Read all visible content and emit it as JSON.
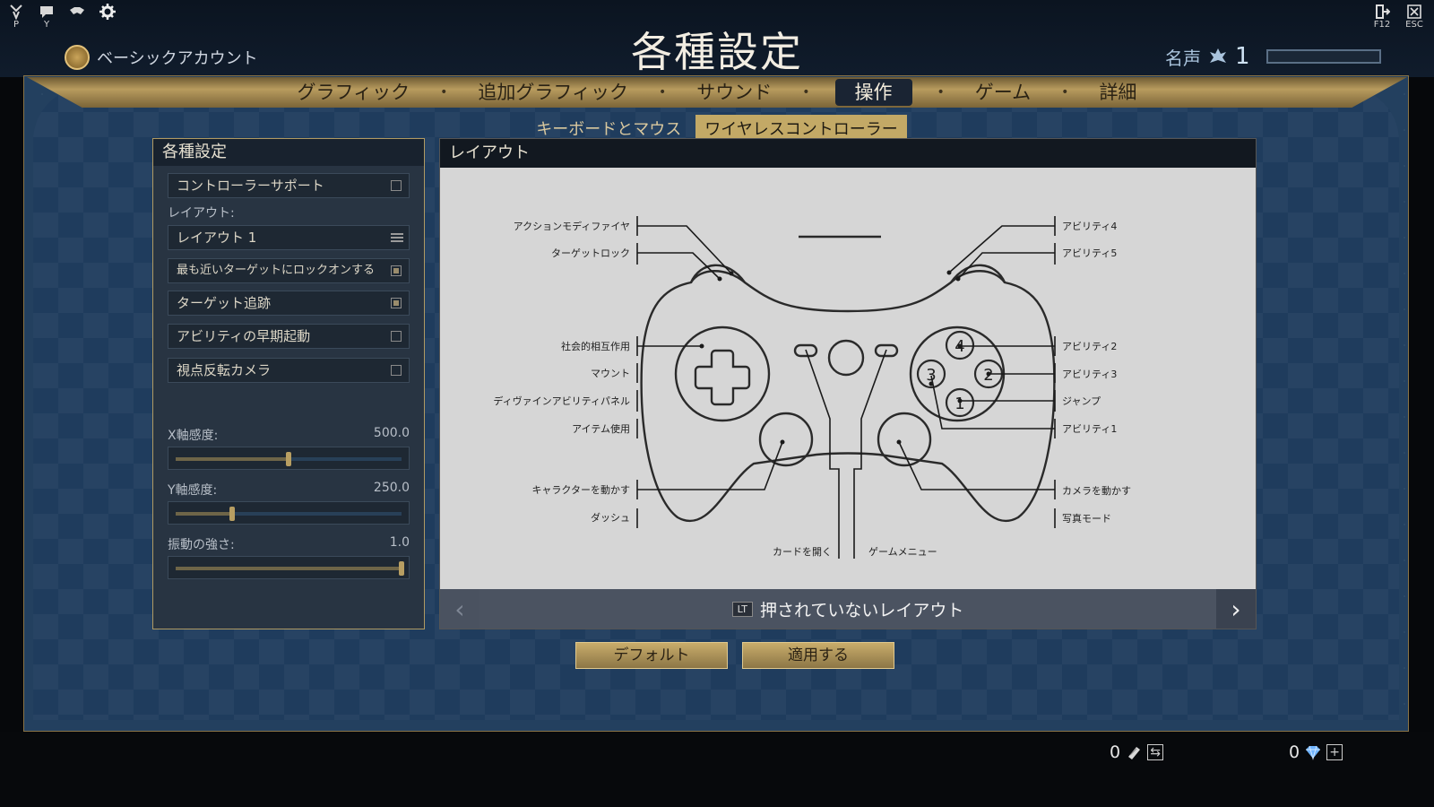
{
  "top_left_icons": [
    {
      "name": "pvp",
      "key": "P"
    },
    {
      "name": "chat",
      "key": "Y"
    },
    {
      "name": "handshake",
      "key": ""
    },
    {
      "name": "settings",
      "key": ""
    }
  ],
  "account": {
    "label": "ベーシックアカウント"
  },
  "title": "各種設定",
  "fame": {
    "label": "名声",
    "value": "1",
    "progress": 0
  },
  "top_right_icons": [
    {
      "name": "exit-door",
      "key": "F12"
    },
    {
      "name": "close",
      "key": "ESC"
    }
  ],
  "tabs": [
    "グラフィック",
    "追加グラフィック",
    "サウンド",
    "操作",
    "ゲーム",
    "詳細"
  ],
  "active_tab": "操作",
  "subtabs": [
    "キーボードとマウス",
    "ワイヤレスコントローラー"
  ],
  "active_subtab": "ワイヤレスコントローラー",
  "settings": {
    "title": "各種設定",
    "controller_support": {
      "label": "コントローラーサポート",
      "checked": false
    },
    "layout_label": "レイアウト:",
    "layout_value": "レイアウト 1",
    "lock_nearest": {
      "label": "最も近いターゲットにロックオンする",
      "checked": true
    },
    "target_tracking": {
      "label": "ターゲット追跡",
      "checked": true
    },
    "early_ability": {
      "label": "アビリティの早期起動",
      "checked": false
    },
    "invert_camera": {
      "label": "視点反転カメラ",
      "checked": false
    },
    "x_sens": {
      "label": "X軸感度:",
      "value": "500.0",
      "fraction": 0.5
    },
    "y_sens": {
      "label": "Y軸感度:",
      "value": "250.0",
      "fraction": 0.25
    },
    "vibration": {
      "label": "振動の強さ:",
      "value": "1.0",
      "fraction": 1.0
    }
  },
  "layout_panel": {
    "title": "レイアウト",
    "labels_left": [
      "アクションモディファイヤ",
      "ターゲットロック",
      "社会的相互作用",
      "マウント",
      "ディヴァインアビリティパネル",
      "アイテム使用",
      "キャラクターを動かす",
      "ダッシュ"
    ],
    "labels_right": [
      "アビリティ4",
      "アビリティ5",
      "アビリティ2",
      "アビリティ3",
      "ジャンプ",
      "アビリティ1",
      "カメラを動かす",
      "写真モード"
    ],
    "labels_bottom": [
      "カードを開く",
      "ゲームメニュー"
    ],
    "face_buttons": [
      "4",
      "2",
      "3",
      "1"
    ],
    "nav_badge": "LT",
    "nav_text": "押されていないレイアウト",
    "nav_prev": "‹",
    "nav_next": "›"
  },
  "buttons": {
    "default": "デフォルト",
    "apply": "適用する"
  },
  "currency": {
    "tickets": "0",
    "gems": "0"
  }
}
